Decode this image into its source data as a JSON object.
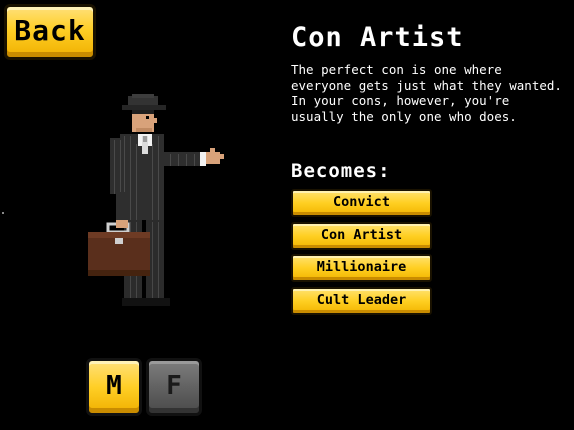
{
  "back_button": {
    "label": "Back"
  },
  "career": {
    "title": "Con Artist",
    "description": "The perfect con is one where everyone gets just what they wanted. In your cons, however, you're usually the only one who does."
  },
  "becomes": {
    "label": "Becomes:",
    "options": [
      {
        "label": "Convict"
      },
      {
        "label": "Con Artist"
      },
      {
        "label": "Millionaire"
      },
      {
        "label": "Cult Leader"
      }
    ]
  },
  "gender": {
    "male_label": "M",
    "female_label": "F",
    "selected": "M"
  },
  "colors": {
    "button_yellow": "#ffcf26",
    "button_gray": "#626262",
    "background": "#000000",
    "suit": "#2e2e2e",
    "briefcase": "#5a2f1c"
  }
}
